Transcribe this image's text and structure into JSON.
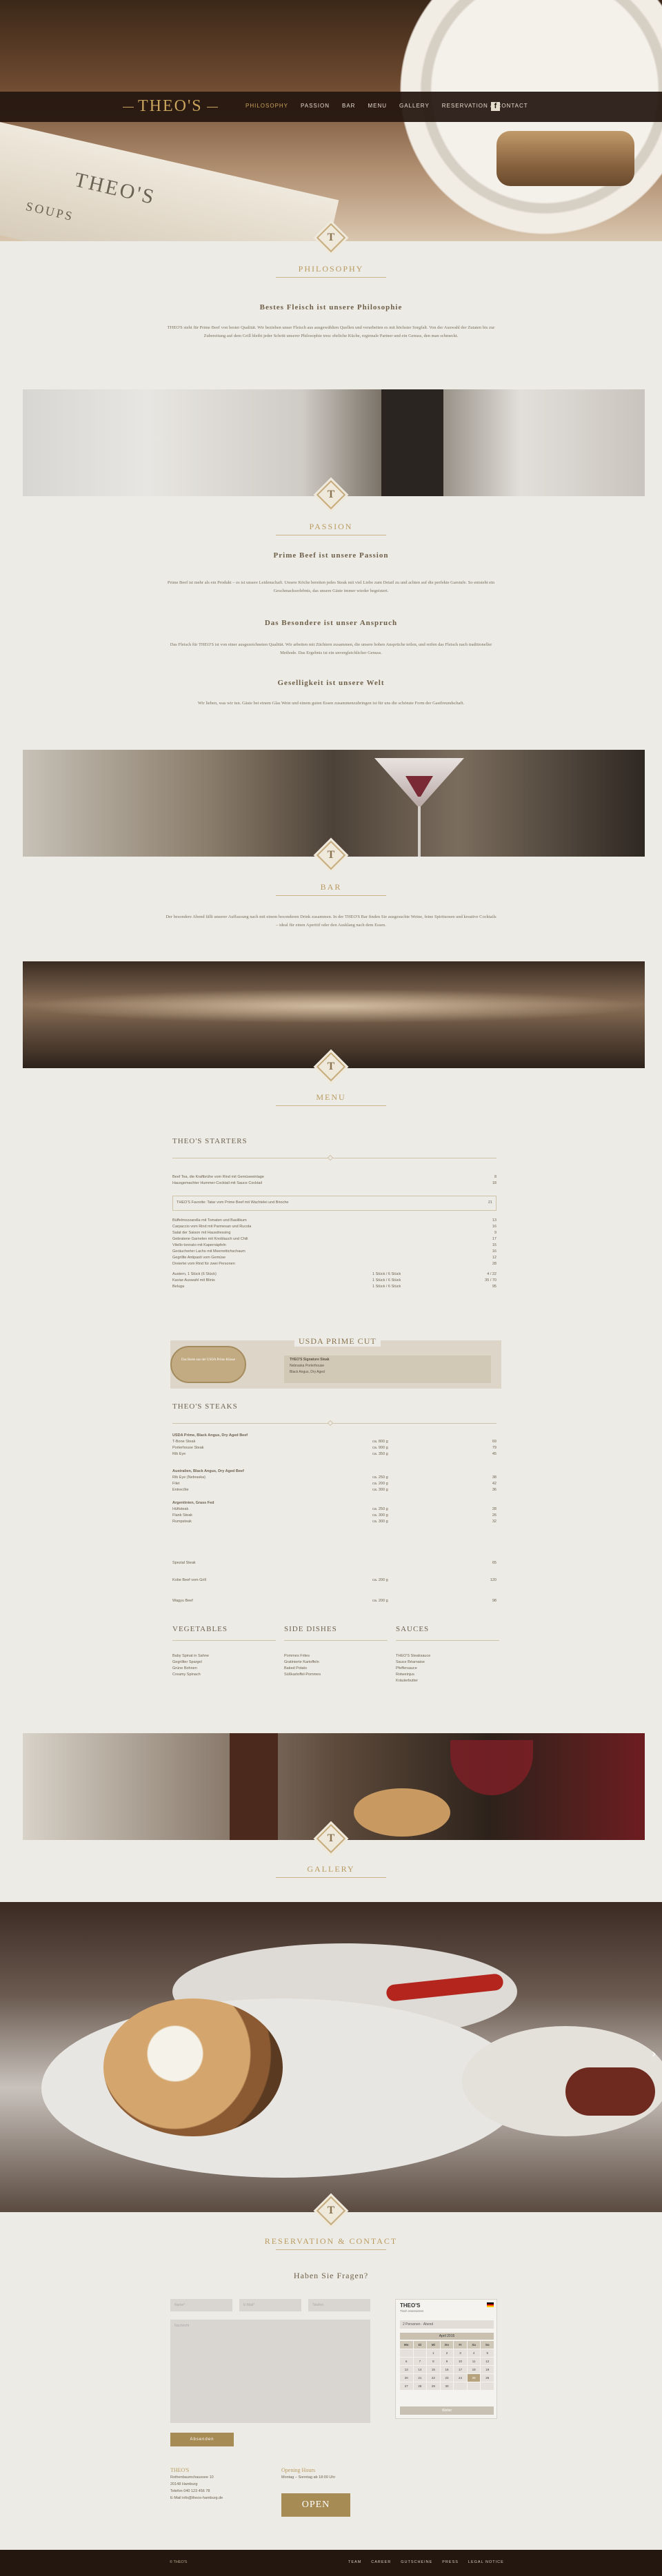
{
  "nav": {
    "logo": "THEO'S",
    "links": [
      "PHILOSOPHY",
      "PASSION",
      "BAR",
      "MENU",
      "GALLERY",
      "RESERVATION & CONTACT"
    ],
    "social_icon": "facebook-icon"
  },
  "hero": {
    "card_logo": "THEO'S",
    "card_text": "SOUPS"
  },
  "badge_letter": "T",
  "philosophy": {
    "title": "PHILOSOPHY",
    "heading": "Bestes Fleisch ist unsere Philosophie",
    "text": "THEO'S steht für Prime Beef von bester Qualität. Wir beziehen unser Fleisch aus ausgewählten Quellen und verarbeiten es mit höchster Sorgfalt. Von der Auswahl der Zutaten bis zur Zubereitung auf dem Grill bleibt jeder Schritt unserer Philosophie treu: ehrliche Küche, regionale Partner und ein Genuss, den man schmeckt."
  },
  "passion": {
    "title": "PASSION",
    "heading1": "Prime Beef ist unsere Passion",
    "text1": "Prime Beef ist mehr als ein Produkt – es ist unsere Leidenschaft. Unsere Köche bereiten jedes Steak mit viel Liebe zum Detail zu und achten auf die perfekte Garstufe. So entsteht ein Geschmackserlebnis, das unsere Gäste immer wieder begeistert.",
    "heading2": "Das Besondere ist unser Anspruch",
    "text2": "Das Fleisch für THEO'S ist von einer ausgezeichneten Qualität. Wir arbeiten mit Züchtern zusammen, die unsere hohen Ansprüche teilen, und reifen das Fleisch nach traditioneller Methode. Das Ergebnis ist ein unvergleichlicher Genuss.",
    "heading3": "Geselligkeit ist unsere Welt",
    "text3": "Wir lieben, was wir tun. Gäste bei einem Glas Wein und einem guten Essen zusammenzubringen ist für uns die schönste Form der Gastfreundschaft."
  },
  "bar": {
    "title": "BAR",
    "text": "Der besondere Abend fällt unserer Auffassung nach mit einem besonderen Drink zusammen. In der THEO'S Bar finden Sie ausgesuchte Weine, feine Spirituosen und kreative Cocktails – ideal für einen Aperitif oder den Ausklang nach dem Essen."
  },
  "menu": {
    "title": "MENU",
    "starters_head": "THEO'S STARTERS",
    "starters": [
      {
        "t": "Beef Tea, die Kraftbrühe vom Rind mit Gemüseeinlage",
        "p": "8"
      },
      {
        "t": "Hausgemachter Hummer-Cocktail mit Sauce Cocktail",
        "p": "18"
      },
      {
        "t": "THEO'S Favorite: Tatar vom Prime Beef mit Wachtelei und Brioche",
        "p": "21"
      },
      {
        "t": "Büffelmozzarella mit Tomaten und Basilikum",
        "p": "13"
      },
      {
        "t": "Carpaccio vom Rind mit Parmesan und Rucola",
        "p": "16"
      },
      {
        "t": "Salat der Saison mit Hausdressing",
        "p": "9"
      },
      {
        "t": "Gebratene Garnelen mit Knoblauch und Chili",
        "p": "17"
      },
      {
        "t": "Vitello tonnato mit Kapernäpfeln",
        "p": "15"
      },
      {
        "t": "Geräucherter Lachs mit Meerrettichschaum",
        "p": "16"
      },
      {
        "t": "Gegrillte Antipasti vom Gemüse",
        "p": "12"
      },
      {
        "t": "Dreierlei vom Rind für zwei Personen",
        "p": "28"
      },
      {
        "t": "Austern, 1 Stück (6 Stück)",
        "q": "1 Stück / 6 Stück",
        "p": "4 / 22"
      },
      {
        "t": "Kaviar-Auswahl mit Blinis",
        "q": "1 Stück / 6 Stück",
        "p": "35 / 70"
      },
      {
        "t": "Beluga",
        "q": "1 Stück / 6 Stück",
        "p": "95"
      }
    ],
    "prime": {
      "title": "USDA PRIME CUT",
      "medal": "Das Beste aus der USDA Prime Klasse",
      "card_title": "THEO'S Signature Steak",
      "card_sub": "Nebraska Porterhouse",
      "card_row": "Black Angus, Dry Aged"
    },
    "steaks_head": "THEO'S STEAKS",
    "steaks": [
      {
        "t": "USDA Prime, Black Angus, Dry Aged Beef",
        "q": "",
        "p": ""
      },
      {
        "t": "T-Bone Steak",
        "q": "ca. 800 g",
        "p": "69"
      },
      {
        "t": "Porterhouse Steak",
        "q": "ca. 900 g",
        "p": "79"
      },
      {
        "t": "Rib Eye",
        "q": "ca. 350 g",
        "p": "45"
      },
      {
        "t": "Australien, Black Angus, Dry Aged Beef",
        "q": "",
        "p": ""
      },
      {
        "t": "Rib Eye (Nebraska)",
        "q": "ca. 250 g",
        "p": "38"
      },
      {
        "t": "Filet",
        "q": "ca. 200 g",
        "p": "42"
      },
      {
        "t": "Entrecôte",
        "q": "ca. 300 g",
        "p": "36"
      },
      {
        "t": "Argentinien, Grass Fed",
        "q": "",
        "p": ""
      },
      {
        "t": "Hüftsteak",
        "q": "ca. 250 g",
        "p": "28"
      },
      {
        "t": "Flank Steak",
        "q": "ca. 300 g",
        "p": "26"
      },
      {
        "t": "Rumpsteak",
        "q": "ca. 300 g",
        "p": "32"
      },
      {
        "t": "Spezial Steak",
        "q": "",
        "p": "65"
      },
      {
        "t": "Kobe Beef vom Grill",
        "q": "ca. 200 g",
        "p": "120"
      },
      {
        "t": "Wagyu Beef",
        "q": "ca. 200 g",
        "p": "98"
      }
    ],
    "col1_head": "VEGETABLES",
    "col1": [
      "Baby Spinat in Sahne",
      "Gegrillter Spargel",
      "Grüne Bohnen",
      "Creamy Spinach"
    ],
    "col2_head": "SIDE DISHES",
    "col2": [
      "Pommes Frites",
      "Gratinierte Kartoffeln",
      "Baked Potato",
      "Süßkartoffel-Pommes"
    ],
    "col3_head": "SAUCES",
    "col3": [
      "THEO'S Steaksauce",
      "Sauce Béarnaise",
      "Pfeffersauce",
      "Rotweinjus",
      "Kräuterbutter"
    ]
  },
  "gallery": {
    "title": "GALLERY",
    "next_icon": "chevron-right-icon"
  },
  "contact": {
    "title": "RESERVATION & CONTACT",
    "question": "Haben Sie Fragen?",
    "placeholders": [
      "Name*",
      "E-Mail*",
      "Telefon"
    ],
    "message_placeholder": "Nachricht",
    "send_label": "Absenden",
    "widget": {
      "logo": "THEO'S",
      "sub": "Tisch reservieren",
      "guests": "2 Personen · Abend",
      "month": "April 2015",
      "weekdays": [
        "Mo",
        "Di",
        "Mi",
        "Do",
        "Fr",
        "Sa",
        "So"
      ],
      "days": [
        "",
        "",
        "1",
        "2",
        "3",
        "4",
        "5",
        "6",
        "7",
        "8",
        "9",
        "10",
        "11",
        "12",
        "13",
        "14",
        "15",
        "16",
        "17",
        "18",
        "19",
        "20",
        "21",
        "22",
        "23",
        "24",
        "25",
        "26",
        "27",
        "28",
        "29",
        "30",
        "",
        "",
        ""
      ],
      "button": "Weiter"
    },
    "address_head": "THEO'S",
    "address": [
      "Rothenbaumchaussee 10",
      "20148 Hamburg",
      "Telefon 040 123 456 78",
      "E-Mail info@theos-hamburg.de"
    ],
    "hours_head": "Opening Hours",
    "hours": "Montag – Sonntag ab 18:00 Uhr",
    "open_label": "OPEN"
  },
  "footer": {
    "copyright": "© THEO'S",
    "links": [
      "TEAM",
      "CAREER",
      "GUTSCHEINE",
      "PRESS",
      "LEGAL NOTICE"
    ]
  }
}
